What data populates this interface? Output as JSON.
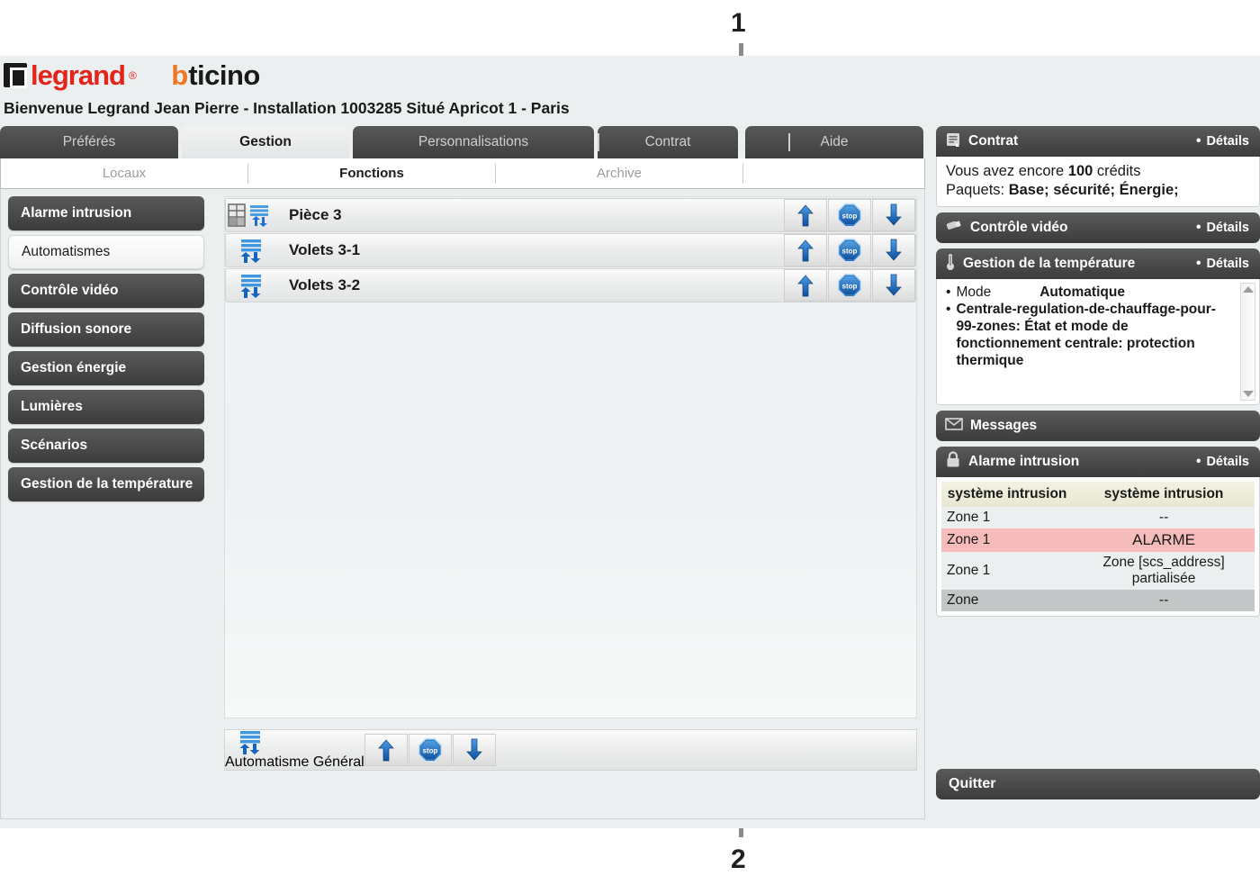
{
  "brand": {
    "legrand": "legrand",
    "legrand_tm": "®",
    "bticino_b": "b",
    "bticino_rest": "ticino"
  },
  "welcome": "Bienvenue Legrand Jean Pierre - Installation 1003285 Situé Apricot 1 - Paris",
  "tabs": [
    {
      "label": "Préférés",
      "active": false
    },
    {
      "label": "Gestion",
      "active": true
    },
    {
      "label": "Personnalisations",
      "active": false
    },
    {
      "label": "Contrat",
      "active": false
    },
    {
      "label": "Aide",
      "active": false
    }
  ],
  "subtabs": [
    {
      "label": "Locaux",
      "active": false
    },
    {
      "label": "Fonctions",
      "active": true
    },
    {
      "label": "Archive",
      "active": false
    }
  ],
  "sidebar": {
    "items": [
      {
        "label": "Alarme intrusion",
        "active": false
      },
      {
        "label": "Automatismes",
        "active": true
      },
      {
        "label": "Contrôle vidéo",
        "active": false
      },
      {
        "label": "Diffusion sonore",
        "active": false
      },
      {
        "label": "Gestion énergie",
        "active": false
      },
      {
        "label": "Lumières",
        "active": false
      },
      {
        "label": "Scénarios",
        "active": false
      },
      {
        "label": "Gestion de la température",
        "active": false
      }
    ]
  },
  "functions": {
    "rows": [
      {
        "label": "Pièce 3",
        "icon": "room-shutter-icon"
      },
      {
        "label": "Volets 3-1",
        "icon": "shutter-icon"
      },
      {
        "label": "Volets 3-2",
        "icon": "shutter-icon"
      }
    ],
    "general": {
      "label": "Automatisme Général",
      "icon": "shutter-icon"
    },
    "controls": {
      "up": "up-arrow-icon",
      "stop": "stop",
      "down": "down-arrow-icon"
    }
  },
  "right": {
    "contrat": {
      "title": "Contrat",
      "details": "Détails",
      "dot": "•",
      "line1_pre": "Vous avez encore ",
      "line1_val": "100",
      "line1_post": " crédits",
      "line2_pre": "Paquets: ",
      "line2_val": "Base; sécurité; Énergie;"
    },
    "video": {
      "title": "Contrôle vidéo",
      "details": "Détails",
      "dot": "•"
    },
    "temperature": {
      "title": "Gestion de la température",
      "details": "Détails",
      "dot": "•",
      "item1_bullet": "•",
      "item1_label": "Mode",
      "item1_value": "Automatique",
      "item2_bullet": "•",
      "item2_text": "Centrale-regulation-de-chauffage-pour-99-zones: État et mode de fonctionnement centrale: protection thermique"
    },
    "messages": {
      "title": "Messages"
    },
    "alarme": {
      "title": "Alarme intrusion",
      "details": "Détails",
      "dot": "•",
      "headers": [
        "système intrusion",
        "système intrusion"
      ],
      "rows": [
        {
          "zone": "Zone 1",
          "state": "--",
          "style": "row-a"
        },
        {
          "zone": "Zone 1",
          "state": "ALARME",
          "style": "row-alarm"
        },
        {
          "zone": "Zone 1",
          "state": "Zone [scs_address] partialisée",
          "style": "row-c"
        },
        {
          "zone": "Zone",
          "state": "--",
          "style": "row-d"
        }
      ]
    },
    "quitter": "Quitter"
  },
  "callouts": [
    {
      "number": "1"
    },
    {
      "number": "2"
    }
  ],
  "colors": {
    "accent_red": "#e1251b",
    "accent_orange": "#ef7622",
    "dark_chrome": "#4a4a4a",
    "alarm_bg": "#f6bcbc",
    "button_blue": "#1f6fd0"
  }
}
